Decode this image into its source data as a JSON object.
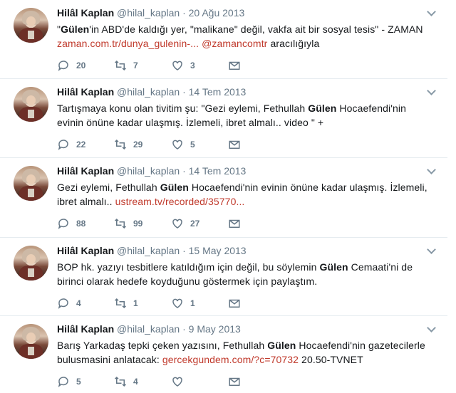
{
  "tweets": [
    {
      "name": "Hilâl Kaplan",
      "handle": "@hilal_kaplan",
      "sep": "·",
      "date": "20 Ağu 2013",
      "segments": [
        {
          "t": "\"",
          "b": false
        },
        {
          "t": "Gülen",
          "b": true
        },
        {
          "t": "'in ABD'de kaldığı yer, \"malikane\" değil, vakfa ait bir sosyal tesis\" - ZAMAN",
          "b": false
        }
      ],
      "line2": [
        {
          "t": "zaman.com.tr/dunya_gulenin-...",
          "link": true
        },
        {
          "t": " ",
          "link": false
        },
        {
          "t": "@zamancomtr",
          "link": true
        },
        {
          "t": " aracılığıyla",
          "link": false
        }
      ],
      "replies": "20",
      "retweets": "7",
      "likes": "3"
    },
    {
      "name": "Hilâl Kaplan",
      "handle": "@hilal_kaplan",
      "sep": "·",
      "date": "14 Tem 2013",
      "segments": [
        {
          "t": "Tartışmaya konu olan tivitim şu: \"Gezi eylemi, Fethullah ",
          "b": false
        },
        {
          "t": "Gülen",
          "b": true
        },
        {
          "t": " Hocaefendi'nin evinin önüne kadar ulaşmış. İzlemeli, ibret almalı.. video \" +",
          "b": false
        }
      ],
      "line2": [],
      "replies": "22",
      "retweets": "29",
      "likes": "5"
    },
    {
      "name": "Hilâl Kaplan",
      "handle": "@hilal_kaplan",
      "sep": "·",
      "date": "14 Tem 2013",
      "segments": [
        {
          "t": "Gezi eylemi, Fethullah ",
          "b": false
        },
        {
          "t": "Gülen",
          "b": true
        },
        {
          "t": " Hocaefendi'nin evinin önüne kadar ulaşmış. İzlemeli, ibret almalı.. ",
          "b": false
        }
      ],
      "line2": [
        {
          "t": "ustream.tv/recorded/35770...",
          "link": true
        }
      ],
      "replies": "88",
      "retweets": "99",
      "likes": "27"
    },
    {
      "name": "Hilâl Kaplan",
      "handle": "@hilal_kaplan",
      "sep": "·",
      "date": "15 May 2013",
      "segments": [
        {
          "t": "BOP hk. yazıyı tesbitlere katıldığım için değil, bu söylemin ",
          "b": false
        },
        {
          "t": "Gülen",
          "b": true
        },
        {
          "t": " Cemaati'ni de birinci olarak hedefe koyduğunu göstermek için paylaştım.",
          "b": false
        }
      ],
      "line2": [],
      "replies": "4",
      "retweets": "1",
      "likes": "1"
    },
    {
      "name": "Hilâl Kaplan",
      "handle": "@hilal_kaplan",
      "sep": "·",
      "date": "9 May 2013",
      "segments": [
        {
          "t": "Barış Yarkadaş tepki çeken yazısını, Fethullah ",
          "b": false
        },
        {
          "t": "Gülen",
          "b": true
        },
        {
          "t": " Hocaefendi'nin gazetecilerle bulusmasini anlatacak: ",
          "b": false
        }
      ],
      "line2": [
        {
          "t": "gercekgundem.com/?c=70732",
          "link": true
        },
        {
          "t": " 20.50-TVNET",
          "link": false
        }
      ],
      "replies": "5",
      "retweets": "4",
      "likes": "0"
    }
  ],
  "colors": {
    "link": "#c0392b",
    "muted": "#657786",
    "text": "#14171a"
  },
  "icons": {
    "reply": "reply-icon",
    "retweet": "retweet-icon",
    "like": "heart-icon",
    "dm": "envelope-icon",
    "menu": "chevron-down-icon"
  }
}
